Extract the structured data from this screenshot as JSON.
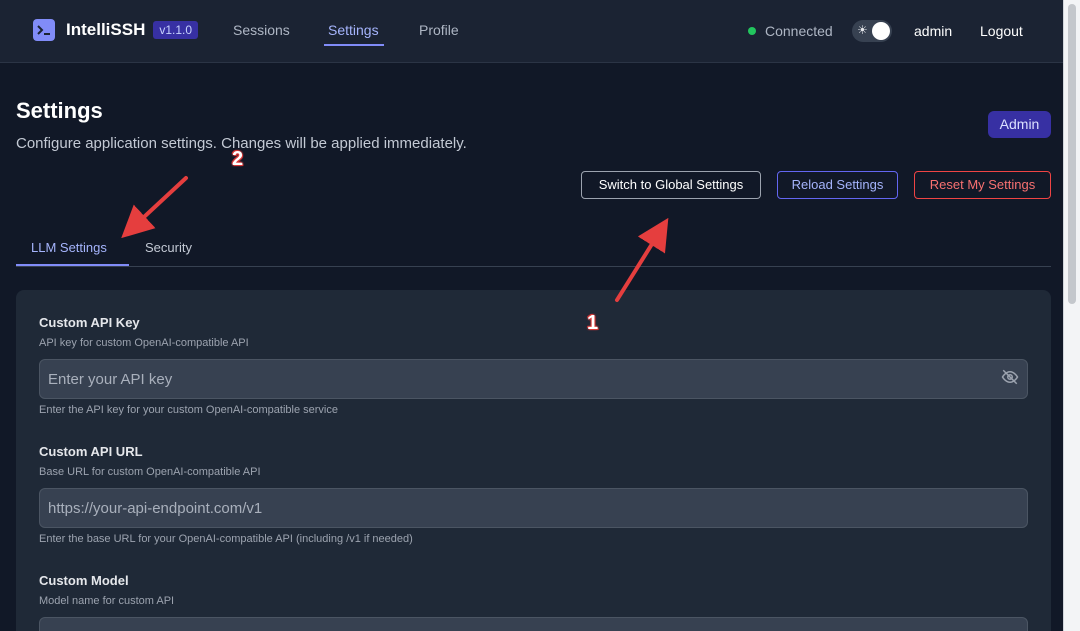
{
  "app": {
    "name": "IntelliSSH",
    "version": "v1.1.0"
  },
  "nav": {
    "links": [
      {
        "label": "Sessions"
      },
      {
        "label": "Settings"
      },
      {
        "label": "Profile"
      }
    ],
    "status": "Connected",
    "theme_icon": "sun-icon",
    "user": "admin",
    "logout": "Logout"
  },
  "page": {
    "title": "Settings",
    "subtitle": "Configure application settings. Changes will be applied immediately.",
    "role_badge": "Admin"
  },
  "actions": {
    "switch_global": "Switch to Global Settings",
    "reload": "Reload Settings",
    "reset": "Reset My Settings"
  },
  "tabs": [
    {
      "label": "LLM Settings"
    },
    {
      "label": "Security"
    }
  ],
  "fields": [
    {
      "label": "Custom API Key",
      "description": "API key for custom OpenAI-compatible API",
      "placeholder": "Enter your API key",
      "help": "Enter the API key for your custom OpenAI-compatible service"
    },
    {
      "label": "Custom API URL",
      "description": "Base URL for custom OpenAI-compatible API",
      "placeholder": "https://your-api-endpoint.com/v1",
      "help": "Enter the base URL for your OpenAI-compatible API (including /v1 if needed)"
    },
    {
      "label": "Custom Model",
      "description": "Model name for custom API"
    }
  ],
  "annotations": [
    {
      "number": "1"
    },
    {
      "number": "2"
    }
  ],
  "colors": {
    "accent": "#818cf8",
    "background": "#111827",
    "card": "#1f2937",
    "danger": "#ef4444",
    "success": "#22c55e",
    "annotation": "#e53e3e"
  }
}
